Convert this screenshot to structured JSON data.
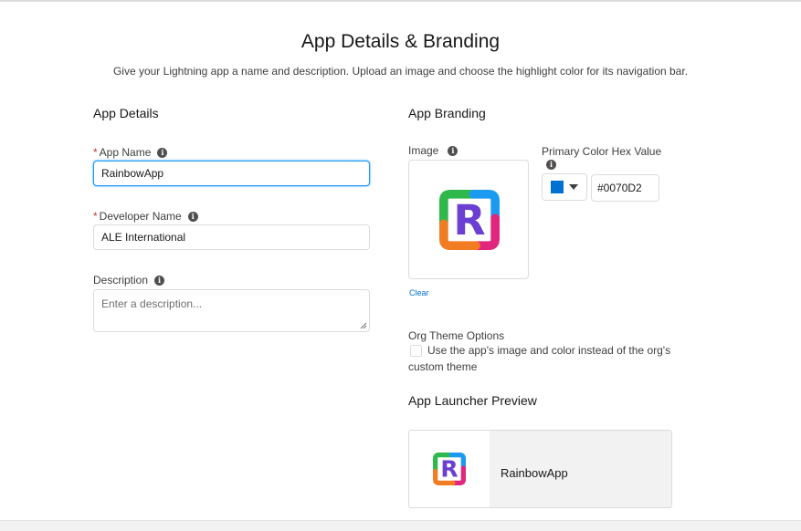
{
  "page": {
    "title": "App Details & Branding",
    "subtitle": "Give your Lightning app a name and description. Upload an image and choose the highlight color for its navigation bar."
  },
  "app_details": {
    "heading": "App Details",
    "app_name": {
      "required": "*",
      "label": "App Name",
      "value": "RainbowApp"
    },
    "developer_name": {
      "required": "*",
      "label": "Developer Name",
      "value": "ALE International"
    },
    "description": {
      "label": "Description",
      "placeholder": "Enter a description..."
    }
  },
  "app_branding": {
    "heading": "App Branding",
    "image_label": "Image",
    "image_logo_letter": "R",
    "clear_label": "Clear",
    "primary_color_label": "Primary Color Hex Value",
    "primary_color_value": "#0070D2",
    "org_theme_label": "Org Theme Options",
    "org_theme_checked": false,
    "org_theme_text_line1": "Use the app's image and color instead of the org's",
    "org_theme_text_line2": "custom theme"
  },
  "launcher_preview": {
    "heading": "App Launcher Preview",
    "app_name": "RainbowApp"
  },
  "icons": {
    "info": "i",
    "logo": "rainbow-r-logo-icon",
    "color_picker": "color-swatch-icon",
    "dropdown": "caret-down-icon",
    "resize_grip": "resize-grip-icon"
  },
  "colors": {
    "accent": "#0070D2",
    "required": "#C23934",
    "logo_green": "#2EB84B",
    "logo_blue": "#1A9BF0",
    "logo_purple": "#6A3FD2",
    "logo_pink": "#E0267D",
    "logo_orange": "#F27C22"
  }
}
